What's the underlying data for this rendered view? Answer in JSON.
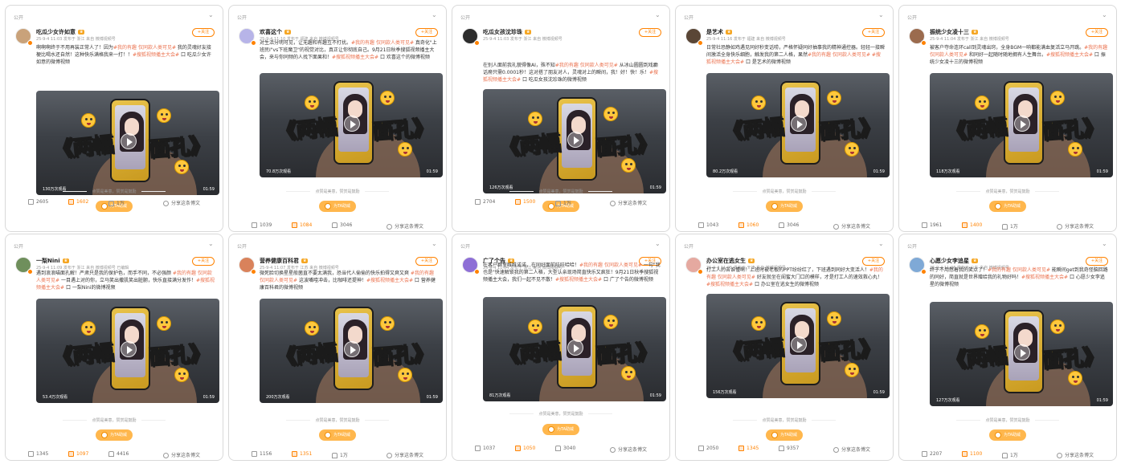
{
  "common": {
    "visibility": "公开",
    "follow_label": "+关注",
    "video_text_left": "《两幅",
    "video_text_right": "面孔》",
    "tip_text": "点赞是美意，赞赏是鼓励",
    "tip_button": "为TA助威",
    "share_label": "分享这条博文",
    "duration": "01:59",
    "accent_color": "#ff8200",
    "tag_color": "#eb7350"
  },
  "posts": [
    {
      "name": "吃瓜少女许如意",
      "meta": "25-9-4 11:03 发布于 浙江  来自 微博视频号",
      "text": "啊啊啊终于不用再装正常人了！因为#我的有趣 仅同款人类可见# 我的灵魂好友接梗比喝水还自然！这种快乐满格我来一打！！#搜狐视频播主大会# 口 吃瓜少女许如意的微博视频",
      "views": "130万次观看",
      "reposts": "2605",
      "comments": "1602",
      "likes": "1万",
      "avatar": "#c9a27a"
    },
    {
      "name": "欢喜这个",
      "meta": "25-9-4 11:10 发布于 福建  来自 微博视频号",
      "text": "对生活分明可见，让无趣和有趣互不打扰。#我的有趣 仅同款人类可见# 真奇化\"上班民I\"vs下班魔卫\"的视觉对比，真正让你彻底自己。9月21日秋季搜狐视频播主大会，来与你同频的人找下面果和！#搜狐视频播主大会# 口 欢喜这个的微博视频",
      "views": "70.8万次观看",
      "reposts": "1039",
      "comments": "1084",
      "likes": "3046",
      "avatar": "#b7b4e8"
    },
    {
      "name": "吃瓜女孩沈珍珠",
      "meta": "25-9-4 11:03 发布于 浙江  来自 微博视频号",
      "text": "在别人面前我礼貌得像AI，殊不知#我的有趣 仅同款人类可见# 从冰山圆圆到戏癫话痨只需0.0001秒！这对搭了朋友对人，灵魂对上的瞬间，我！好！快！乐！#搜狐视频播主大会# 口 吃瓜女孩沈珍珠的微博视频",
      "views": "126万次观看",
      "reposts": "2704",
      "comments": "1500",
      "likes": "1万",
      "avatar": "#2d2d2d"
    },
    {
      "name": "是艺术",
      "meta": "25-9-4 11:16 发布于 福建  来自 微博视频号",
      "text": "日常社恐静如鸡遇见同好秒变话唠，严格怀疑同好抽事我的精神通控器。轻轻一接瞬间激活全身快乐细胞，触发我的第二人格，果然#我的有趣 仅同款人类可见# #搜狐视频播主大会# 口 是艺术的微博视频",
      "views": "80.2万次观看",
      "reposts": "1043",
      "comments": "1060",
      "likes": "3046",
      "avatar": "#5a4636"
    },
    {
      "name": "振统少女凌十三",
      "meta": "25-9-4 11:04 发布于 浙江  来自 微博视频号",
      "text": "被客户夺命连环call到灵魂出窍，全身BGM一响都能满血复活立马开跳。#我的有趣 仅同款人类可见# 和同好一起随时随地拥有人生舞台。#搜狐视频播主大会# 口 振统少女凌十三的微博视频",
      "views": "118万次观看",
      "reposts": "1961",
      "comments": "1400",
      "likes": "1万",
      "avatar": "#9b6b4e"
    },
    {
      "name": "一梨Nini",
      "meta": "25-9-4 11:09 发布于 浙江  来自 微博视频号 已编辑",
      "text": "遇到浪浪喵面孔解！严肃只是我的保护色，而手不同，不必强颜 #我的有趣 仅同款人类可见# 一目遇上对的你，立马笑出撒肌笑出脏腑，快乐直接满分发作！#搜狐视频播主大会# 口 一梨Nini的微博视频",
      "views": "53.4万次观看",
      "reposts": "1345",
      "comments": "1097",
      "likes": "4416",
      "avatar": "#6f8f5c"
    },
    {
      "name": "营养健康百科君",
      "meta": "25-9-4 11:07 发布于 江苏  来自 微博视频号",
      "text": "微死脸切换星星般菌直不要太满我，恐当代人偷偷的快乐拍得又爽又爽 #我的有趣 仅同款人类可见# 这波嘴噎冲击，比咖啡还提神！#搜狐视频播主大会# 口 营养健康百科君的微博视频",
      "views": "200万次观看",
      "reposts": "1156",
      "comments": "1351",
      "likes": "1万",
      "avatar": "#d9825b"
    },
    {
      "name": "广了个告",
      "meta": "25-9-4 11:04 发布于 浙江  来自 微博视频号",
      "text": "在客户群里唯唯诺诺，在同好面前哇哇哈哈！#我的有趣 仅同款人类可见# 一句\"我也是\"快速解锁我的第二人格，大型认亲现场简直快乐又疯狂！9月21日秋季搜狐视频播主大会，我们一起不见不散！#搜狐视频播主大会# 口 广了个告的微博视频",
      "views": "81万次观看",
      "reposts": "1037",
      "comments": "1050",
      "likes": "3040",
      "avatar": "#8e6fd6"
    },
    {
      "name": "办公室在逃女生",
      "meta": "25-9-4 11:05 发布于 天津  来自 微博视频号",
      "text": "打工人的苦谁懂啊！上班时被老板的PPT纷纷红了，下班遇到同好大变活人！#我的有趣 仅同款人类可见# 好友就坐在闺蜜大门口的模样，才是打工人的速效救心丸！#搜狐视频播主大会# 口 办公室在逃女生的微博视频",
      "views": "156万次观看",
      "reposts": "2050",
      "comments": "1345",
      "likes": "9357",
      "avatar": "#e5a9a0"
    },
    {
      "name": "心愿少女李追星",
      "meta": "25-9-4 11:06 发布于 山东  来自 微博视频号",
      "text": "终于不用憋着我的笑点了！#我的有趣 仅同款人类可见# 能瞬间get到我奇怪脑回路的同好，简直就是世界赠给我的礼物好吗！#搜狐视频播主大会# 口 心愿少女李追星的微博视频",
      "views": "127万次观看",
      "reposts": "2207",
      "comments": "1100",
      "likes": "1万",
      "avatar": "#7fa9d6"
    }
  ]
}
